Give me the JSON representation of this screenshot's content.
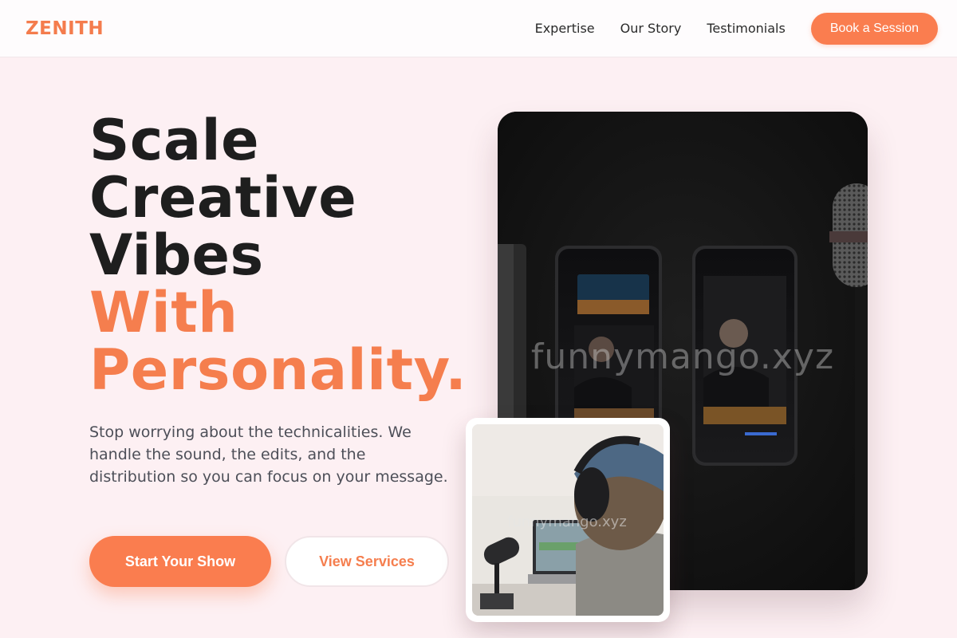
{
  "header": {
    "logo": "ZENITH",
    "nav": [
      {
        "label": "Expertise"
      },
      {
        "label": "Our Story"
      },
      {
        "label": "Testimonials"
      }
    ],
    "cta_label": "Book a Session"
  },
  "hero": {
    "headline_lines": [
      "Scale",
      "Creative",
      "Vibes"
    ],
    "accent_lines": [
      "With",
      "Personality."
    ],
    "subcopy": "Stop worrying about the technicalities. We handle the sound, the edits, and the distribution so you can focus on your message.",
    "primary_button": "Start Your Show",
    "secondary_button": "View Services"
  },
  "media": {
    "main_image_watermark": "funnymango.xyz",
    "inset_image_watermark": "funnymango.xyz"
  },
  "colors": {
    "accent": "#fa7d4f",
    "background": "#fdf0f3",
    "headline": "#1e1e1e",
    "body_text": "#4d4f58"
  }
}
